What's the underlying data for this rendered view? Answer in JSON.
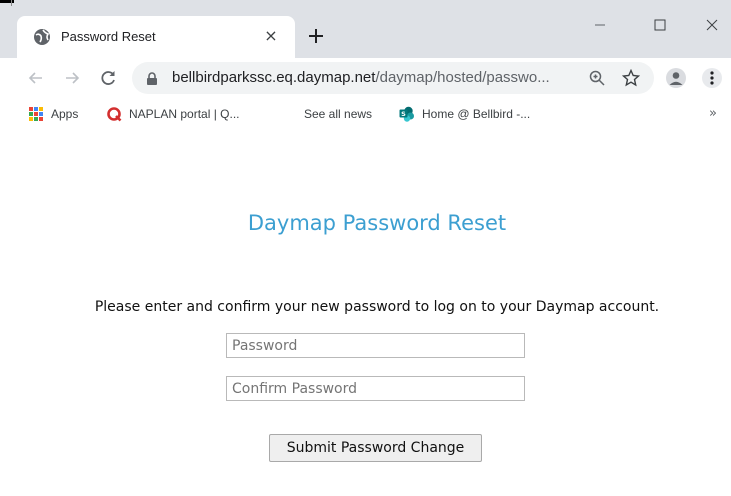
{
  "browser": {
    "tab": {
      "title": "Password Reset",
      "close_glyph": "×"
    },
    "new_tab_glyph": "+",
    "window_controls": [
      "minimize-icon",
      "maximize-icon",
      "close-icon"
    ],
    "address": {
      "host": "bellbirdparkssc.eq.daymap.net",
      "path": "/daymap/hosted/passwo..."
    },
    "bookmarks": [
      {
        "label": "Apps",
        "icon": "apps-grid-icon"
      },
      {
        "label": "NAPLAN portal | Q...",
        "icon": "naplan-q-icon"
      },
      {
        "label": "See all news",
        "icon": ""
      },
      {
        "label": "Home @ Bellbird -...",
        "icon": "sharepoint-icon"
      }
    ],
    "bookmarks_overflow": "»"
  },
  "page": {
    "heading": "Daymap Password Reset",
    "instruction": "Please enter and confirm your new password to log on to your Daymap account.",
    "password": {
      "placeholder": "Password",
      "value": ""
    },
    "confirm_password": {
      "placeholder": "Confirm Password",
      "value": ""
    },
    "submit_label": "Submit Password Change"
  },
  "colors": {
    "heading": "#3c9fd1",
    "titlebar": "#dee1e6",
    "omnibox": "#f1f3f4"
  }
}
